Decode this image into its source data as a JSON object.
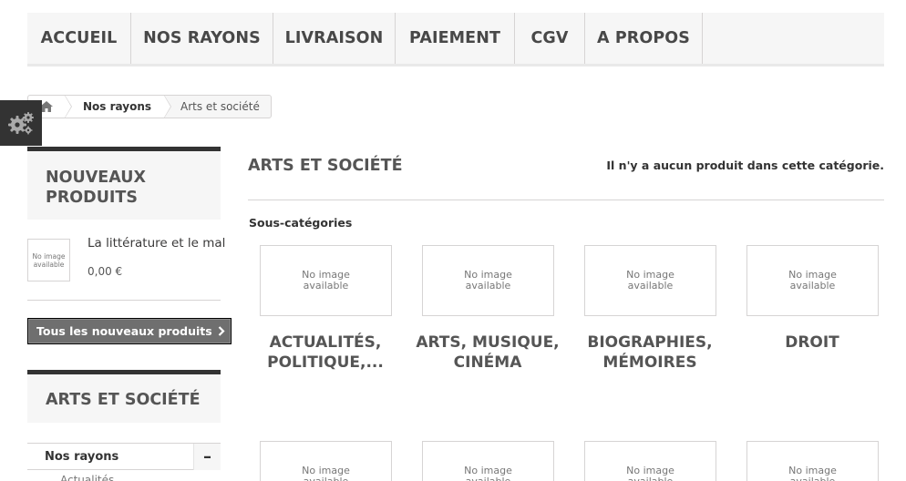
{
  "nav": {
    "items": [
      {
        "label": "ACCUEIL"
      },
      {
        "label": "NOS RAYONS"
      },
      {
        "label": "LIVRAISON"
      },
      {
        "label": "PAIEMENT"
      },
      {
        "label": "CGV"
      },
      {
        "label": "A PROPOS"
      }
    ]
  },
  "breadcrumb": {
    "home_icon": "home-icon",
    "link": "Nos rayons",
    "current": "Arts et société"
  },
  "settings": {
    "icon": "gears-icon"
  },
  "new_products": {
    "title": "NOUVEAUX PRODUITS",
    "item": {
      "image_text": "No image available",
      "name": "La littérature et le mal",
      "price": "0,00 €"
    },
    "button_label": "Tous les nouveaux produits",
    "button_icon": "chevron-right-icon"
  },
  "category_block": {
    "title": "ARTS ET SOCIÉTÉ",
    "tree_label": "Nos rayons",
    "toggle_label": "–",
    "sub_item_cut": "Actualités..."
  },
  "main": {
    "heading": "ARTS ET SOCIÉTÉ",
    "counter": "Il n'y a aucun produit dans cette catégorie.",
    "subcategories_label": "Sous-catégories",
    "subcategories": [
      {
        "name": "ACTUALITÉS, POLITIQUE,...",
        "image_text": "No image available"
      },
      {
        "name": "ARTS, MUSIQUE, CINÉMA",
        "image_text": "No image available"
      },
      {
        "name": "BIOGRAPHIES, MÉMOIRES",
        "image_text": "No image available"
      },
      {
        "name": "DROIT",
        "image_text": "No image available"
      }
    ],
    "subcategories_row2": [
      {
        "image_text": "No image available"
      },
      {
        "image_text": "No image available"
      },
      {
        "image_text": "No image available"
      },
      {
        "image_text": "No image available"
      }
    ]
  }
}
